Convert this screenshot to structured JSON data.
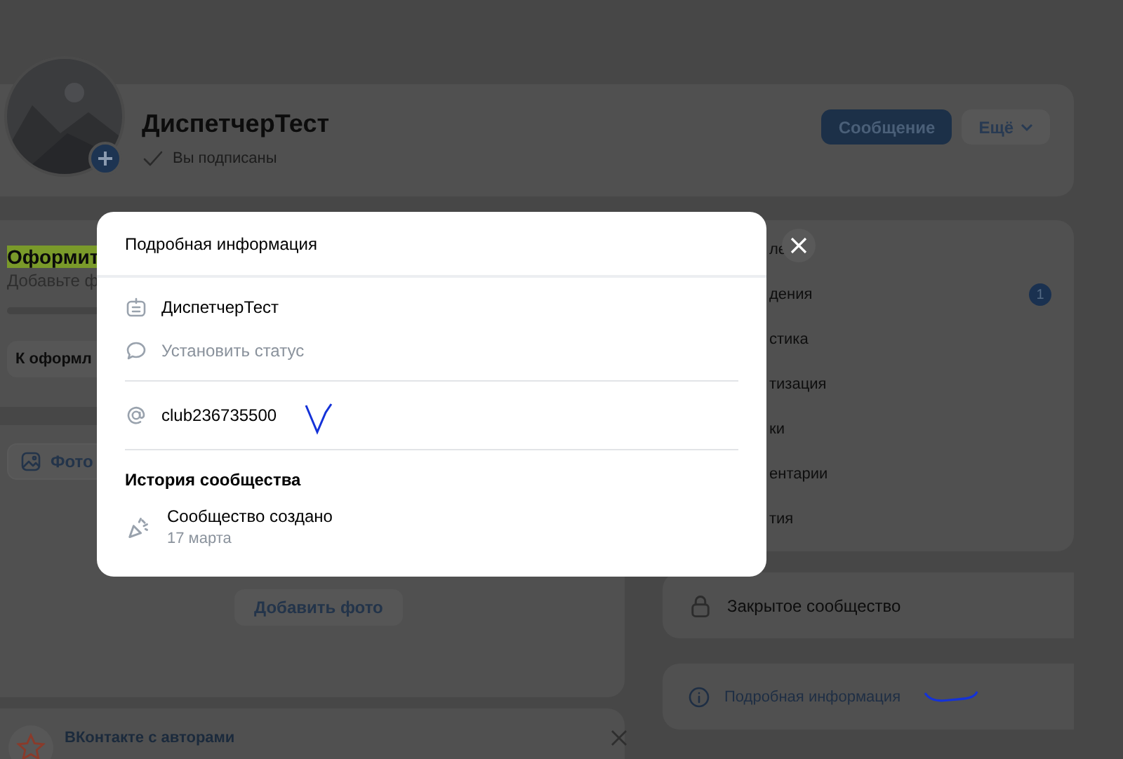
{
  "header": {
    "name": "ДиспетчерТест",
    "subscribed": true,
    "subscribed_label": "Вы подписаны",
    "buttons": [
      {
        "label": "Сообщение",
        "kind": "primary"
      },
      {
        "label": "Ещё",
        "kind": "dropdown"
      }
    ]
  },
  "setup_card": {
    "title": "Оформит",
    "subtitle": "Добавьте ф",
    "button": "К оформл"
  },
  "photos_card": {
    "tab": "Фото",
    "add_button": "Добавить фото"
  },
  "promo_card": {
    "title": "ВКонтакте с авторами"
  },
  "side_menu": [
    {
      "label": "ле"
    },
    {
      "label": "дения",
      "badge": "1"
    },
    {
      "label": "стика"
    },
    {
      "label": "тизация"
    },
    {
      "label": "ки"
    },
    {
      "label": "ентарии"
    },
    {
      "label": "тия"
    }
  ],
  "privacy": {
    "label": "Закрытое сообщество"
  },
  "details_link": {
    "label": "Подробная информация"
  },
  "modal": {
    "title": "Подробная информация",
    "rows": [
      {
        "kind": "name",
        "text": "ДиспетчерТест"
      },
      {
        "kind": "status",
        "text": "Установить статус"
      }
    ],
    "address": "club236735500",
    "history": {
      "title": "История сообщества",
      "events": [
        {
          "text": "Сообщество создано",
          "date": "17 марта"
        }
      ]
    }
  }
}
